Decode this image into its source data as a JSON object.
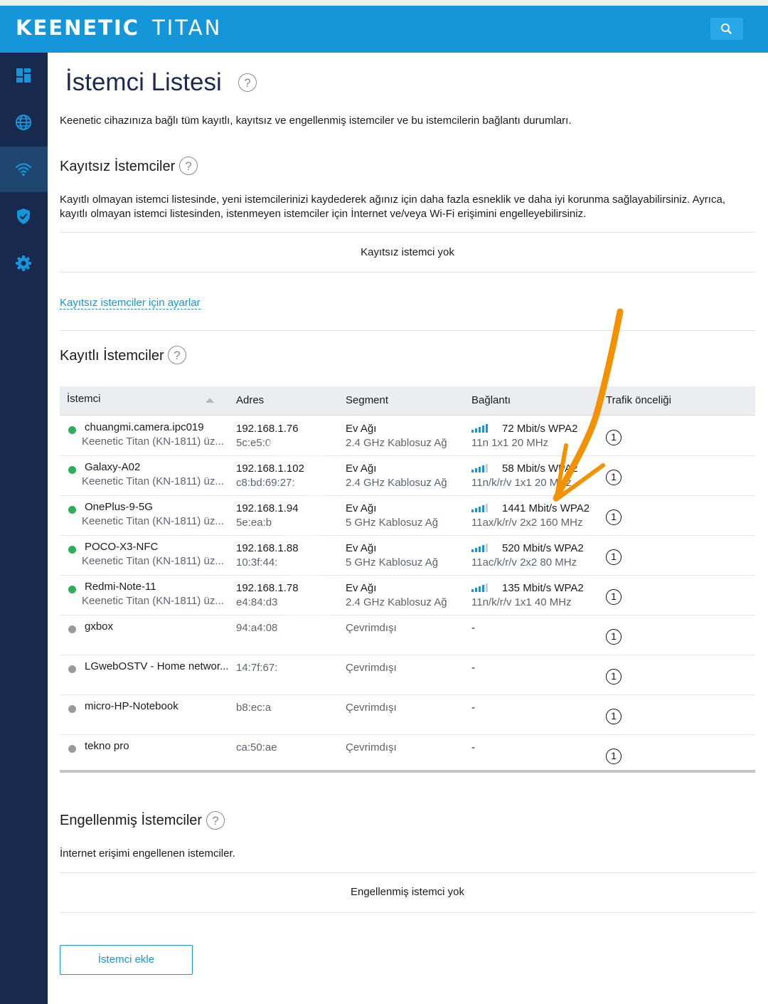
{
  "header": {
    "brand_main": "KEENETIC",
    "brand_model": "TITAN"
  },
  "sidebar": {
    "items": [
      {
        "name": "dashboard",
        "icon": "dashboard-icon",
        "active": false
      },
      {
        "name": "internet",
        "icon": "globe-icon",
        "active": false
      },
      {
        "name": "wifi",
        "icon": "wifi-icon",
        "active": true
      },
      {
        "name": "security",
        "icon": "shield-icon",
        "active": false
      },
      {
        "name": "settings",
        "icon": "gear-icon",
        "active": false
      }
    ]
  },
  "page": {
    "title": "İstemci Listesi",
    "help_glyph": "?",
    "description": "Keenetic cihazınıza bağlı tüm kayıtlı, kayıtsız ve engellenmiş istemciler ve bu istemcilerin bağlantı durumları."
  },
  "unregistered": {
    "heading": "Kayıtsız İstemciler",
    "description": "Kayıtlı olmayan istemci listesinde, yeni istemcilerinizi kaydederek ağınız için daha fazla esneklik ve daha iyi korunma sağlayabilirsiniz. Ayrıca, kayıtlı olmayan istemci listesinden, istenmeyen istemciler için İnternet ve/veya Wi-Fi erişimini engelleyebilirsiniz.",
    "empty_message": "Kayıtsız istemci yok",
    "settings_link": "Kayıtsız istemciler için ayarlar"
  },
  "registered": {
    "heading": "Kayıtlı İstemciler",
    "columns": {
      "client": "İstemci",
      "address": "Adres",
      "segment": "Segment",
      "connection": "Bağlantı",
      "priority": "Trafik önceliği"
    },
    "rows": [
      {
        "name": "chuangmi.camera.ipc019",
        "device": "Keenetic Titan (KN-1811) üz...",
        "ip": "192.168.1.76",
        "mac": "5c:e5:0c",
        "segment": "Ev Ağı",
        "band": "2.4 GHz Kablosuz Ağ",
        "rate": "72 Mbit/s WPA2",
        "mode": "11n 1x1 20 MHz",
        "priority": "①",
        "online": true
      },
      {
        "name": "Galaxy-A02",
        "device": "Keenetic Titan (KN-1811) üz...",
        "ip": "192.168.1.102",
        "mac": "c8:bd:69:27:",
        "segment": "Ev Ağı",
        "band": "2.4 GHz Kablosuz Ağ",
        "rate": "58 Mbit/s WPA2",
        "mode": "11n/k/r/v 1x1 20 MHz",
        "priority": "①",
        "online": true
      },
      {
        "name": "OnePlus-9-5G",
        "device": "Keenetic Titan (KN-1811) üz...",
        "ip": "192.168.1.94",
        "mac": "5e:ea:b",
        "segment": "Ev Ağı",
        "band": "5 GHz Kablosuz Ağ",
        "rate": "1441 Mbit/s WPA2",
        "mode": "11ax/k/r/v 2x2 160 MHz",
        "priority": "①",
        "online": true
      },
      {
        "name": "POCO-X3-NFC",
        "device": "Keenetic Titan (KN-1811) üz...",
        "ip": "192.168.1.88",
        "mac": "10:3f:44:",
        "segment": "Ev Ağı",
        "band": "5 GHz Kablosuz Ağ",
        "rate": "520 Mbit/s WPA2",
        "mode": "11ac/k/r/v 2x2 80 MHz",
        "priority": "①",
        "online": true
      },
      {
        "name": "Redmi-Note-11",
        "device": "Keenetic Titan (KN-1811) üz...",
        "ip": "192.168.1.78",
        "mac": "e4:84:d3",
        "segment": "Ev Ağı",
        "band": "2.4 GHz Kablosuz Ağ",
        "rate": "135 Mbit/s WPA2",
        "mode": "11n/k/r/v 1x1 40 MHz",
        "priority": "①",
        "online": true
      },
      {
        "name": "gxbox",
        "mac": "94:a4:08",
        "segment": "Çevrimdışı",
        "connection": "-",
        "priority": "①",
        "online": false
      },
      {
        "name": "LGwebOSTV - Home networ...",
        "mac": "14:7f:67:",
        "segment": "Çevrimdışı",
        "connection": "-",
        "priority": "①",
        "online": false
      },
      {
        "name": "micro-HP-Notebook",
        "mac": "b8:ec:a",
        "segment": "Çevrimdışı",
        "connection": "-",
        "priority": "①",
        "online": false
      },
      {
        "name": "tekno pro",
        "mac": "ca:50:ae",
        "segment": "Çevrimdışı",
        "connection": "-",
        "priority": "①",
        "online": false
      }
    ]
  },
  "blocked": {
    "heading": "Engellenmiş İstemciler",
    "description": "İnternet erişimi engellenen istemciler.",
    "empty_message": "Engellenmiş istemci yok"
  },
  "actions": {
    "add_client": "İstemci ekle"
  },
  "colors": {
    "header_bg": "#1596d9",
    "sidebar_bg": "#172a4e",
    "sidebar_active": "#1e4670",
    "icon_blue": "#1596d9",
    "online_dot": "#2fae5a",
    "offline_dot": "#9a9a9a",
    "annotation_arrow": "#f39200"
  }
}
